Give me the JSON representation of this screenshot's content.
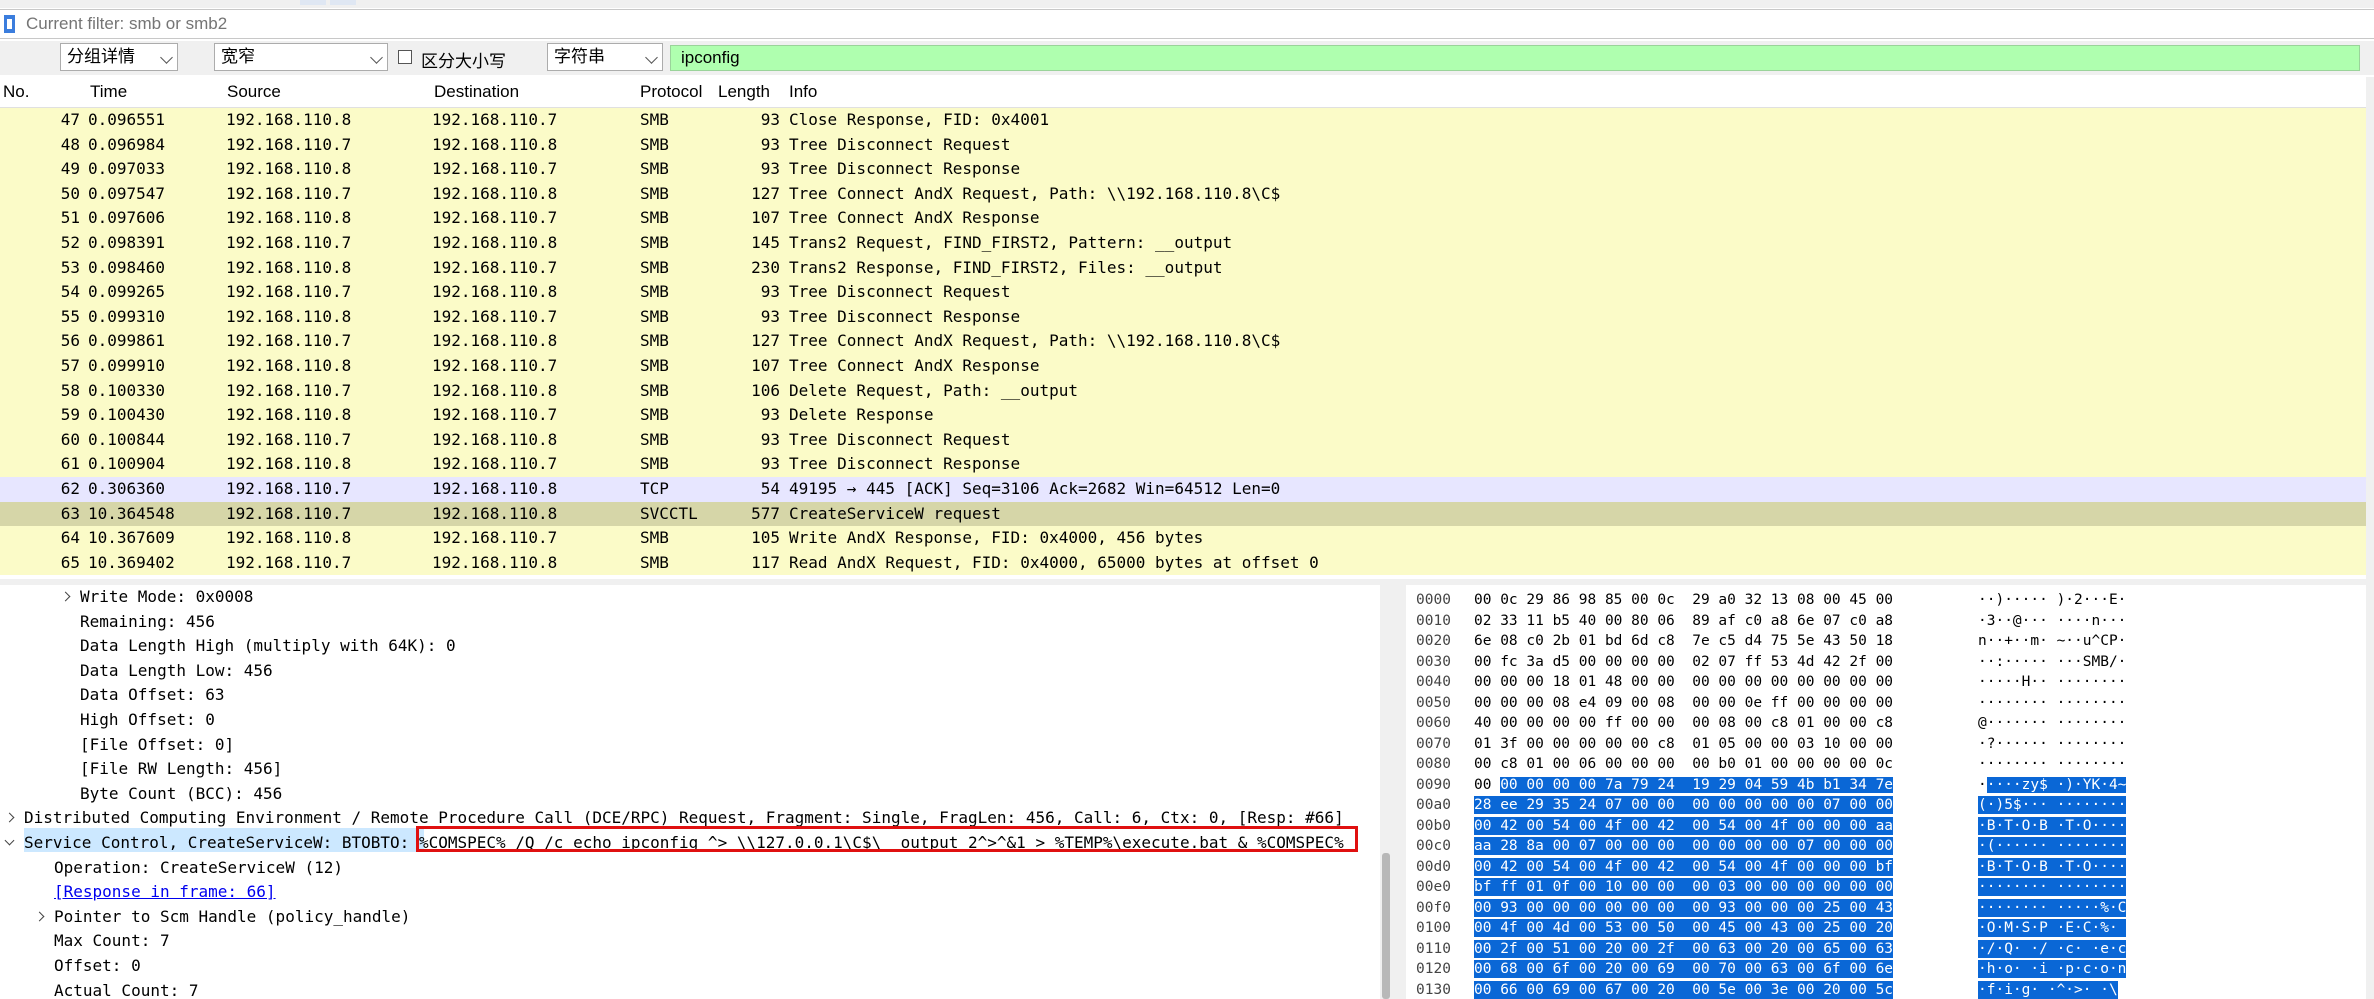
{
  "filter": {
    "placeholder": "Current filter: smb or smb2"
  },
  "search": {
    "display_select": "分组详情",
    "char_select": "宽窄",
    "case_sensitive_label": "区分大小写",
    "type_select": "字符串",
    "query": "ipconfig"
  },
  "packet_list": {
    "columns": [
      "No.",
      "Time",
      "Source",
      "Destination",
      "Protocol",
      "Length",
      "Info"
    ],
    "rows": [
      {
        "no": "47",
        "time": "0.096551",
        "src": "192.168.110.8",
        "dst": "192.168.110.7",
        "proto": "SMB",
        "len": "93",
        "info": "Close Response, FID: 0x4001",
        "bg": "#fbfbc8"
      },
      {
        "no": "48",
        "time": "0.096984",
        "src": "192.168.110.7",
        "dst": "192.168.110.8",
        "proto": "SMB",
        "len": "93",
        "info": "Tree Disconnect Request",
        "bg": "#fbfbc8"
      },
      {
        "no": "49",
        "time": "0.097033",
        "src": "192.168.110.8",
        "dst": "192.168.110.7",
        "proto": "SMB",
        "len": "93",
        "info": "Tree Disconnect Response",
        "bg": "#fbfbc8"
      },
      {
        "no": "50",
        "time": "0.097547",
        "src": "192.168.110.7",
        "dst": "192.168.110.8",
        "proto": "SMB",
        "len": "127",
        "info": "Tree Connect AndX Request, Path: \\\\192.168.110.8\\C$",
        "bg": "#fbfbc8"
      },
      {
        "no": "51",
        "time": "0.097606",
        "src": "192.168.110.8",
        "dst": "192.168.110.7",
        "proto": "SMB",
        "len": "107",
        "info": "Tree Connect AndX Response",
        "bg": "#fbfbc8"
      },
      {
        "no": "52",
        "time": "0.098391",
        "src": "192.168.110.7",
        "dst": "192.168.110.8",
        "proto": "SMB",
        "len": "145",
        "info": "Trans2 Request, FIND_FIRST2, Pattern: __output",
        "bg": "#fbfbc8"
      },
      {
        "no": "53",
        "time": "0.098460",
        "src": "192.168.110.8",
        "dst": "192.168.110.7",
        "proto": "SMB",
        "len": "230",
        "info": "Trans2 Response, FIND_FIRST2, Files: __output",
        "bg": "#fbfbc8"
      },
      {
        "no": "54",
        "time": "0.099265",
        "src": "192.168.110.7",
        "dst": "192.168.110.8",
        "proto": "SMB",
        "len": "93",
        "info": "Tree Disconnect Request",
        "bg": "#fbfbc8"
      },
      {
        "no": "55",
        "time": "0.099310",
        "src": "192.168.110.8",
        "dst": "192.168.110.7",
        "proto": "SMB",
        "len": "93",
        "info": "Tree Disconnect Response",
        "bg": "#fbfbc8"
      },
      {
        "no": "56",
        "time": "0.099861",
        "src": "192.168.110.7",
        "dst": "192.168.110.8",
        "proto": "SMB",
        "len": "127",
        "info": "Tree Connect AndX Request, Path: \\\\192.168.110.8\\C$",
        "bg": "#fbfbc8"
      },
      {
        "no": "57",
        "time": "0.099910",
        "src": "192.168.110.8",
        "dst": "192.168.110.7",
        "proto": "SMB",
        "len": "107",
        "info": "Tree Connect AndX Response",
        "bg": "#fbfbc8"
      },
      {
        "no": "58",
        "time": "0.100330",
        "src": "192.168.110.7",
        "dst": "192.168.110.8",
        "proto": "SMB",
        "len": "106",
        "info": "Delete Request, Path: __output",
        "bg": "#fbfbc8"
      },
      {
        "no": "59",
        "time": "0.100430",
        "src": "192.168.110.8",
        "dst": "192.168.110.7",
        "proto": "SMB",
        "len": "93",
        "info": "Delete Response",
        "bg": "#fbfbc8"
      },
      {
        "no": "60",
        "time": "0.100844",
        "src": "192.168.110.7",
        "dst": "192.168.110.8",
        "proto": "SMB",
        "len": "93",
        "info": "Tree Disconnect Request",
        "bg": "#fbfbc8"
      },
      {
        "no": "61",
        "time": "0.100904",
        "src": "192.168.110.8",
        "dst": "192.168.110.7",
        "proto": "SMB",
        "len": "93",
        "info": "Tree Disconnect Response",
        "bg": "#fbfbc8"
      },
      {
        "no": "62",
        "time": "0.306360",
        "src": "192.168.110.7",
        "dst": "192.168.110.8",
        "proto": "TCP",
        "len": "54",
        "info": "49195 → 445 [ACK] Seq=3106 Ack=2682 Win=64512 Len=0",
        "bg": "#e7e6ff"
      },
      {
        "no": "63",
        "time": "10.364548",
        "src": "192.168.110.7",
        "dst": "192.168.110.8",
        "proto": "SVCCTL",
        "len": "577",
        "info": "CreateServiceW request",
        "bg": "#d6d6a8"
      },
      {
        "no": "64",
        "time": "10.367609",
        "src": "192.168.110.8",
        "dst": "192.168.110.7",
        "proto": "SMB",
        "len": "105",
        "info": "Write AndX Response, FID: 0x4000, 456 bytes",
        "bg": "#fbfbc8"
      },
      {
        "no": "65",
        "time": "10.369402",
        "src": "192.168.110.7",
        "dst": "192.168.110.8",
        "proto": "SMB",
        "len": "117",
        "info": "Read AndX Request, FID: 0x4000, 65000 bytes at offset 0",
        "bg": "#fbfbc8"
      }
    ]
  },
  "details": {
    "rows": [
      {
        "indent": 1,
        "arrow": "right",
        "text": "Write Mode: 0x0008"
      },
      {
        "indent": 1,
        "arrow": "",
        "text": "Remaining: 456"
      },
      {
        "indent": 1,
        "arrow": "",
        "text": "Data Length High (multiply with 64K): 0"
      },
      {
        "indent": 1,
        "arrow": "",
        "text": "Data Length Low: 456"
      },
      {
        "indent": 1,
        "arrow": "",
        "text": "Data Offset: 63"
      },
      {
        "indent": 1,
        "arrow": "",
        "text": "High Offset: 0"
      },
      {
        "indent": 1,
        "arrow": "",
        "text": "[File Offset: 0]"
      },
      {
        "indent": 1,
        "arrow": "",
        "text": "[File RW Length: 456]"
      },
      {
        "indent": 1,
        "arrow": "",
        "text": "Byte Count (BCC): 456"
      },
      {
        "indent": 0,
        "arrow": "right",
        "text": "Distributed Computing Environment / Remote Procedure Call (DCE/RPC) Request, Fragment: Single, FragLen: 456, Call: 6, Ctx: 0, [Resp: #66]"
      },
      {
        "indent": 0,
        "arrow": "down",
        "text": "Service Control, CreateServiceW: BTOBTO: %COMSPEC% /Q /c echo ipconfig ^> \\\\127.0.0.1\\C$\\__output 2^>^&1 > %TEMP%\\execute.bat & %COMSPEC%"
      },
      {
        "indent": 2,
        "arrow": "",
        "text": "Operation: CreateServiceW (12)"
      },
      {
        "indent": 2,
        "arrow": "",
        "text": "[Response in frame: 66]",
        "link": true
      },
      {
        "indent": 2,
        "arrow": "right",
        "text": "Pointer to Scm Handle (policy_handle)"
      },
      {
        "indent": 2,
        "arrow": "",
        "text": "Max Count: 7"
      },
      {
        "indent": 2,
        "arrow": "",
        "text": "Offset: 0"
      },
      {
        "indent": 2,
        "arrow": "",
        "text": "Actual Count: 7"
      }
    ]
  },
  "bytes": {
    "rows": [
      {
        "off": "0000",
        "hex": "00 0c 29 86 98 85 00 0c  29 a0 32 13 08 00 45 00",
        "asc": "··)····· )·2···E·",
        "sel": 0
      },
      {
        "off": "0010",
        "hex": "02 33 11 b5 40 00 80 06  89 af c0 a8 6e 07 c0 a8",
        "asc": "·3··@··· ····n···",
        "sel": 0
      },
      {
        "off": "0020",
        "hex": "6e 08 c0 2b 01 bd 6d c8  7e c5 d4 75 5e 43 50 18",
        "asc": "n··+··m· ~··u^CP·",
        "sel": 0
      },
      {
        "off": "0030",
        "hex": "00 fc 3a d5 00 00 00 00  02 07 ff 53 4d 42 2f 00",
        "asc": "··:····· ···SMB/·",
        "sel": 0
      },
      {
        "off": "0040",
        "hex": "00 00 00 18 01 48 00 00  00 00 00 00 00 00 00 00",
        "asc": "·····H·· ········",
        "sel": 0
      },
      {
        "off": "0050",
        "hex": "00 00 00 08 e4 09 00 08  00 00 0e ff 00 00 00 00",
        "asc": "········ ········",
        "sel": 0
      },
      {
        "off": "0060",
        "hex": "40 00 00 00 00 ff 00 00  00 08 00 c8 01 00 00 c8",
        "asc": "@······· ········",
        "sel": 0
      },
      {
        "off": "0070",
        "hex": "01 3f 00 00 00 00 00 c8  01 05 00 00 03 10 00 00",
        "asc": "·?······ ········",
        "sel": 0
      },
      {
        "off": "0080",
        "hex": "00 c8 01 00 06 00 00 00  00 b0 01 00 00 00 00 0c",
        "asc": "········ ········",
        "sel": 0
      },
      {
        "off": "0090",
        "hex": "00 00 00 00 00 7a 79 24  19 29 04 59 4b b1 34 7e",
        "asc": "·····zy$ ·)·YK·4~",
        "sel": 1
      },
      {
        "off": "00a0",
        "hex": "28 ee 29 35 24 07 00 00  00 00 00 00 00 07 00 00",
        "asc": "(·)5$··· ········",
        "sel": 2
      },
      {
        "off": "00b0",
        "hex": "00 42 00 54 00 4f 00 42  00 54 00 4f 00 00 00 aa",
        "asc": "·B·T·O·B ·T·O····",
        "sel": 2
      },
      {
        "off": "00c0",
        "hex": "aa 28 8a 00 07 00 00 00  00 00 00 00 07 00 00 00",
        "asc": "·(······ ········",
        "sel": 2
      },
      {
        "off": "00d0",
        "hex": "00 42 00 54 00 4f 00 42  00 54 00 4f 00 00 00 bf",
        "asc": "·B·T·O·B ·T·O····",
        "sel": 2
      },
      {
        "off": "00e0",
        "hex": "bf ff 01 0f 00 10 00 00  00 03 00 00 00 00 00 00",
        "asc": "········ ········",
        "sel": 2
      },
      {
        "off": "00f0",
        "hex": "00 93 00 00 00 00 00 00  00 93 00 00 00 25 00 43",
        "asc": "········ ·····%·C",
        "sel": 2
      },
      {
        "off": "0100",
        "hex": "00 4f 00 4d 00 53 00 50  00 45 00 43 00 25 00 20",
        "asc": "·O·M·S·P ·E·C·%· ",
        "sel": 2
      },
      {
        "off": "0110",
        "hex": "00 2f 00 51 00 20 00 2f  00 63 00 20 00 65 00 63",
        "asc": "·/·Q· ·/ ·c· ·e·c",
        "sel": 2
      },
      {
        "off": "0120",
        "hex": "00 68 00 6f 00 20 00 69  00 70 00 63 00 6f 00 6e",
        "asc": "·h·o· ·i ·p·c·o·n",
        "sel": 2
      },
      {
        "off": "0130",
        "hex": "00 66 00 69 00 67 00 20  00 5e 00 3e 00 20 00 5c",
        "asc": "·f·i·g· ·^·>· ·\\",
        "sel": 2
      }
    ]
  },
  "colors": {
    "smb_row": "#fbfbc8",
    "tcp_row": "#e7e6ff",
    "svcctl_row": "#d6d6a8",
    "search_ok": "#afffaf",
    "selection": "#0a67d6",
    "highlight_box": "#e01010"
  }
}
